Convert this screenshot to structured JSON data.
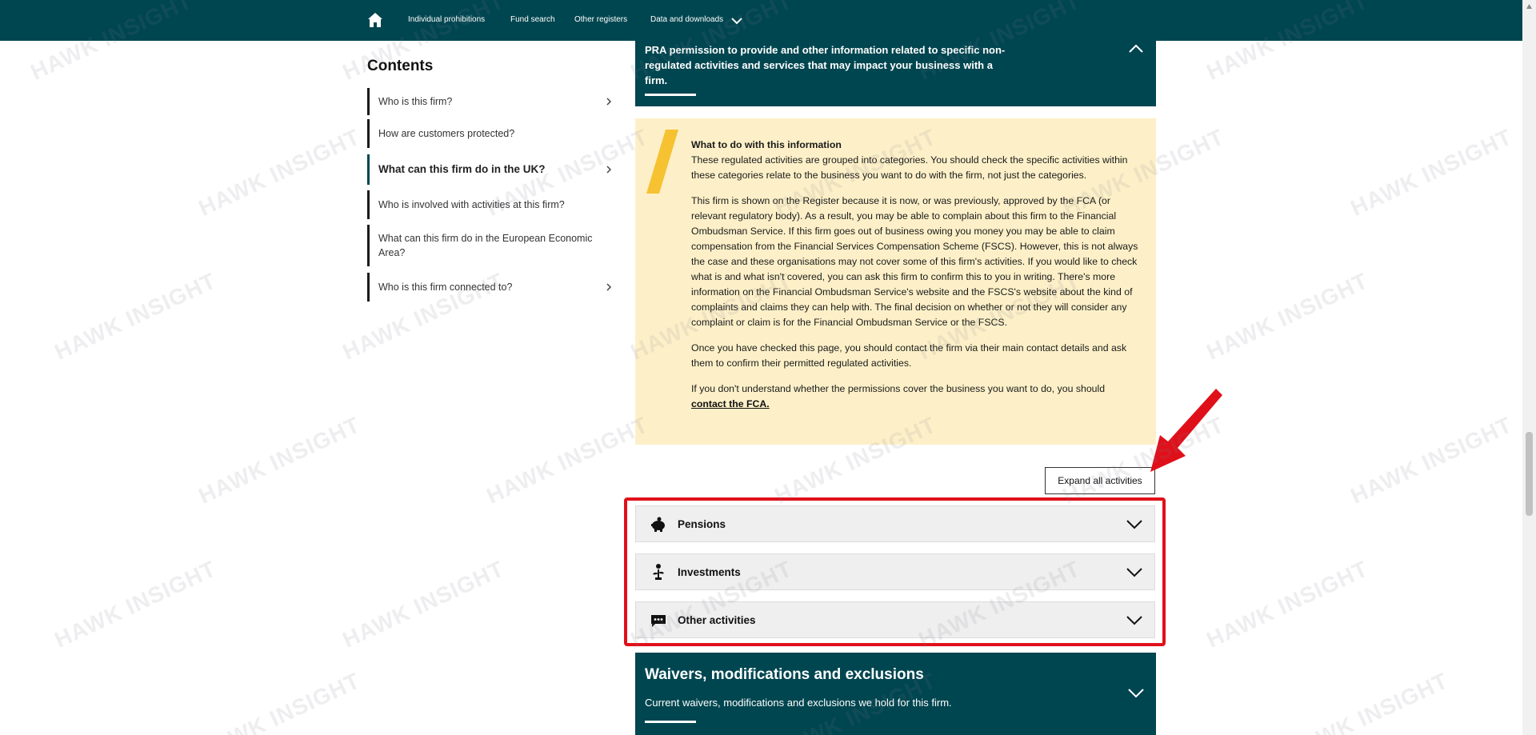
{
  "nav": {
    "links": [
      "Individual prohibitions",
      "Fund search",
      "Other registers",
      "Data and downloads"
    ]
  },
  "contents": {
    "title": "Contents",
    "items": [
      {
        "label": "Who is this firm?"
      },
      {
        "label": "How are customers protected?"
      },
      {
        "label": "What can this firm do in the UK?"
      },
      {
        "label": "Who is involved with activities at this firm?"
      },
      {
        "label": "What can this firm do in the European Economic Area?"
      },
      {
        "label": "Who is this firm connected to?"
      }
    ]
  },
  "pra_panel": {
    "text": "PRA permission to provide and other information related to specific non-regulated activities and services that may impact your business with a firm."
  },
  "info": {
    "heading": "What to do with this information",
    "p1": "These regulated activities are grouped into categories. You should check the specific activities within these categories relate to the business you want to do with the firm, not just the categories.",
    "p2": "This firm is shown on the Register because it is now, or was previously, approved by the FCA (or relevant regulatory body). As a result, you may be able to complain about this firm to the Financial Ombudsman Service. If this firm goes out of business owing you money you may be able to claim compensation from the Financial Services Compensation Scheme (FSCS). However, this is not always the case and these organisations may not cover some of this firm's activities. If you would like to check what is and what isn't covered, you can ask this firm to confirm this to you in writing. There's more information on the Financial Ombudsman Service's website and the FSCS's website about the kind of complaints and claims they can help with. The final decision on whether or not they will consider any complaint or claim is for the Financial Ombudsman Service or the FSCS.",
    "p3": "Once you have checked this page, you should contact the firm via their main contact details and ask them to confirm their permitted regulated activities.",
    "p4": "If you don't understand whether the permissions cover the business you want to do, you should",
    "link": "contact the FCA."
  },
  "expand_all_label": "Expand all activities",
  "accordions": [
    {
      "label": "Pensions",
      "icon": "piggy-bank-icon"
    },
    {
      "label": "Investments",
      "icon": "plant-coin-icon"
    },
    {
      "label": "Other activities",
      "icon": "chat-dots-icon"
    }
  ],
  "waivers": {
    "title": "Waivers, modifications and exclusions",
    "subtitle": "Current waivers, modifications and exclusions we hold for this firm."
  },
  "watermark_text": "HAWK INSIGHT",
  "colors": {
    "brand_teal": "#004650",
    "info_bg": "#fdf0c8",
    "accent_yellow": "#f6c231",
    "annotation_red": "#e0101a"
  }
}
